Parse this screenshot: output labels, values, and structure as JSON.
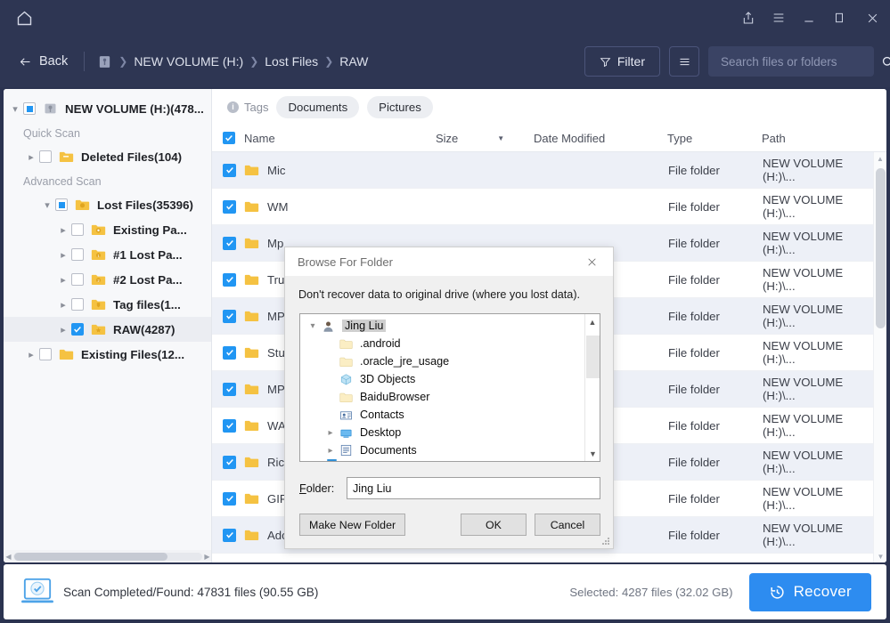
{
  "titlebar": {
    "home_icon": "home-icon",
    "buttons": [
      {
        "name": "share-icon",
        "label": "Share"
      },
      {
        "name": "menu-icon",
        "label": "Menu"
      },
      {
        "name": "minimize-icon",
        "label": "Minimize"
      },
      {
        "name": "maximize-icon",
        "label": "Maximize"
      },
      {
        "name": "close-icon",
        "label": "Close"
      }
    ]
  },
  "navbar": {
    "back_label": "Back",
    "breadcrumbs": [
      "NEW VOLUME (H:)",
      "Lost Files",
      "RAW"
    ],
    "filter_label": "Filter",
    "search_placeholder": "Search files or folders",
    "search_value": ""
  },
  "sidebar": {
    "root": {
      "label": "NEW VOLUME (H:)(478...",
      "expanded": true,
      "check": "partial"
    },
    "groups": [
      {
        "title": "Quick Scan",
        "items": [
          {
            "label": "Deleted Files(104)",
            "check": "none",
            "expanded": false,
            "indent": 1,
            "icon": "folder-deleted-icon"
          }
        ]
      },
      {
        "title": "Advanced Scan",
        "items": [
          {
            "label": "Lost Files(35396)",
            "check": "partial",
            "expanded": true,
            "indent": 1,
            "icon": "folder-lost-icon"
          },
          {
            "label": "Existing Pa...",
            "check": "none",
            "expanded": false,
            "indent": 2,
            "icon": "folder-existing-icon"
          },
          {
            "label": "#1 Lost Pa...",
            "check": "none",
            "expanded": false,
            "indent": 2,
            "icon": "folder-partition-icon"
          },
          {
            "label": "#2 Lost Pa...",
            "check": "none",
            "expanded": false,
            "indent": 2,
            "icon": "folder-partition-icon"
          },
          {
            "label": "Tag files(1...",
            "check": "none",
            "expanded": false,
            "indent": 2,
            "icon": "folder-tag-icon"
          },
          {
            "label": "RAW(4287)",
            "check": "checked",
            "expanded": false,
            "indent": 2,
            "icon": "folder-raw-icon",
            "selected": true
          },
          {
            "label": "Existing Files(12...",
            "check": "none",
            "expanded": false,
            "indent": 1,
            "icon": "folder-icon"
          }
        ]
      }
    ],
    "hscroll": true
  },
  "filelist": {
    "tags_label": "Tags",
    "chips": [
      "Documents",
      "Pictures"
    ],
    "columns": [
      "Name",
      "Size",
      "Date Modified",
      "Type",
      "Path"
    ],
    "select_all_checked": true,
    "sorted_column": "Size",
    "rows": [
      {
        "name": "Mic",
        "size": "",
        "date": "",
        "type": "File folder",
        "path": "NEW VOLUME (H:)\\...",
        "checked": true
      },
      {
        "name": "WM",
        "size": "",
        "date": "",
        "type": "File folder",
        "path": "NEW VOLUME (H:)\\...",
        "checked": true
      },
      {
        "name": "Mp",
        "size": "",
        "date": "",
        "type": "File folder",
        "path": "NEW VOLUME (H:)\\...",
        "checked": true
      },
      {
        "name": "Tru",
        "size": "",
        "date": "",
        "type": "File folder",
        "path": "NEW VOLUME (H:)\\...",
        "checked": true
      },
      {
        "name": "MP",
        "size": "",
        "date": "",
        "type": "File folder",
        "path": "NEW VOLUME (H:)\\...",
        "checked": true
      },
      {
        "name": "Stu",
        "size": "",
        "date": "",
        "type": "File folder",
        "path": "NEW VOLUME (H:)\\...",
        "checked": true
      },
      {
        "name": "MP",
        "size": "",
        "date": "",
        "type": "File folder",
        "path": "NEW VOLUME (H:)\\...",
        "checked": true
      },
      {
        "name": "WA",
        "size": "",
        "date": "",
        "type": "File folder",
        "path": "NEW VOLUME (H:)\\...",
        "checked": true
      },
      {
        "name": "Rich Text Document",
        "size": "",
        "date": "",
        "type": "File folder",
        "path": "NEW VOLUME (H:)\\...",
        "checked": true
      },
      {
        "name": "GIF graphics file",
        "size": "",
        "date": "",
        "type": "File folder",
        "path": "NEW VOLUME (H:)\\...",
        "checked": true
      },
      {
        "name": "Adobe Photoshop file",
        "size": "",
        "date": "",
        "type": "File folder",
        "path": "NEW VOLUME (H:)\\...",
        "checked": true
      }
    ]
  },
  "dialog": {
    "title": "Browse For Folder",
    "note": "Don't recover data to original drive (where you lost data).",
    "tree": [
      {
        "label": "Jing Liu",
        "indent": 0,
        "expanded": true,
        "selected": true,
        "icon": "user-icon"
      },
      {
        "label": ".android",
        "indent": 1,
        "expanded": null,
        "selected": false,
        "icon": "folder-faded-icon"
      },
      {
        "label": ".oracle_jre_usage",
        "indent": 1,
        "expanded": null,
        "selected": false,
        "icon": "folder-faded-icon"
      },
      {
        "label": "3D Objects",
        "indent": 1,
        "expanded": null,
        "selected": false,
        "icon": "3d-objects-icon"
      },
      {
        "label": "BaiduBrowser",
        "indent": 1,
        "expanded": null,
        "selected": false,
        "icon": "folder-faded-icon"
      },
      {
        "label": "Contacts",
        "indent": 1,
        "expanded": null,
        "selected": false,
        "icon": "contacts-icon"
      },
      {
        "label": "Desktop",
        "indent": 1,
        "expanded": false,
        "selected": false,
        "icon": "desktop-icon"
      },
      {
        "label": "Documents",
        "indent": 1,
        "expanded": false,
        "selected": false,
        "icon": "documents-icon"
      }
    ],
    "folder_label": "Folder:",
    "folder_value": "Jing Liu",
    "buttons": {
      "new_folder": "Make New Folder",
      "ok": "OK",
      "cancel": "Cancel"
    }
  },
  "statusbar": {
    "scan_text": "Scan Completed/Found: 47831 files (90.55 GB)",
    "selected_text": "Selected: 4287 files (32.02 GB)",
    "recover_label": "Recover"
  },
  "colors": {
    "header_bg": "#2e3653",
    "accent": "#2d8cf0",
    "checkbox": "#2196f3",
    "row_alt": "#edf0f7",
    "folder_yellow": "#f5c242"
  }
}
